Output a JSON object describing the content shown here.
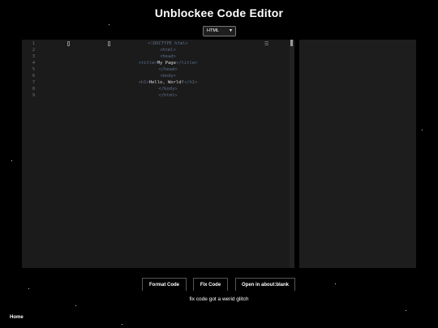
{
  "title": "Unblockee Code Editor",
  "language_select": {
    "selected": "HTML"
  },
  "editor": {
    "line_numbers": [
      "1",
      "2",
      "3",
      "4",
      "5",
      "6",
      "7",
      "8",
      "9"
    ],
    "lines": [
      {
        "tag_open": "<!DOCTYPE html>",
        "text": "",
        "tag_close": ""
      },
      {
        "tag_open": "<html>",
        "text": "",
        "tag_close": ""
      },
      {
        "tag_open": "<head>",
        "text": "",
        "tag_close": ""
      },
      {
        "tag_open": "<title>",
        "text": "My Page",
        "tag_close": "</title>"
      },
      {
        "tag_open": "</head>",
        "text": "",
        "tag_close": ""
      },
      {
        "tag_open": "<body>",
        "text": "",
        "tag_close": ""
      },
      {
        "tag_open": "<h1>",
        "text": "Hello, World!",
        "tag_close": "</h1>"
      },
      {
        "tag_open": "</body>",
        "text": "",
        "tag_close": ""
      },
      {
        "tag_open": "</html>",
        "text": "",
        "tag_close": ""
      }
    ]
  },
  "buttons": {
    "format": "Format Code",
    "fix": "Fix Code",
    "open_blank": "Open in about:blank"
  },
  "status_text": "fix code got a werid glitch",
  "footer": {
    "home": "Home"
  }
}
